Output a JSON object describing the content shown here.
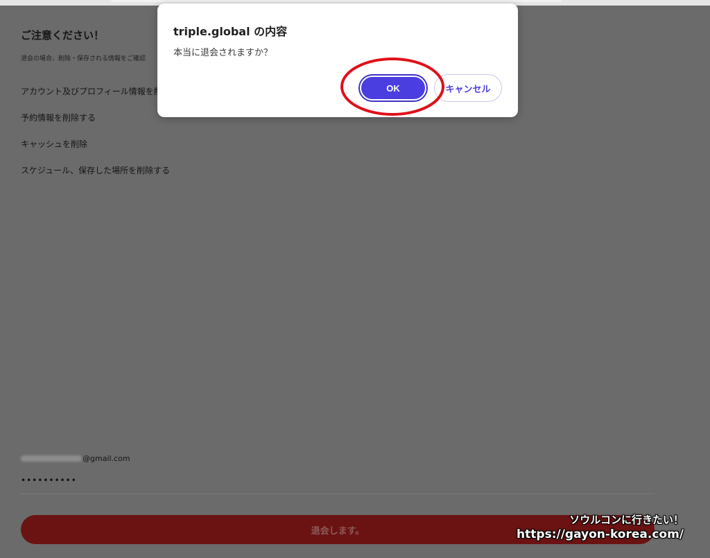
{
  "background_content": {
    "notice_title": "ご注意ください！",
    "notice_subtitle": "退会の場合、削除・保存される情報をご確認",
    "items": [
      "アカウント及びプロフィール情報を削除",
      "予約情報を削除する",
      "キャッシュを削除",
      "スケジュール、保存した場所を削除する"
    ],
    "email_domain": "@gmail.com",
    "password_mask": "••••••••••",
    "withdraw_label": "退会します。"
  },
  "dialog": {
    "title": "triple.global の内容",
    "message": "本当に退会されますか？",
    "ok_label": "OK",
    "cancel_label": "キャンセル"
  },
  "watermark": {
    "line1": "ソウルコンに行きたい！",
    "line2": "https://gayon-korea.com/"
  },
  "colors": {
    "accent": "#4a3ee0",
    "overlay": "#6b6b6b",
    "withdraw": "#6b1313",
    "highlight": "#e0101a"
  }
}
